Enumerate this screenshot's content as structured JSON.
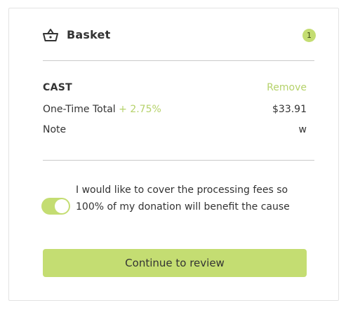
{
  "basket": {
    "title": "Basket",
    "count": "1",
    "icon": "basket-icon"
  },
  "item": {
    "name": "CAST",
    "remove_label": "Remove",
    "total_label": "One-Time Total",
    "fee_label": "+ 2.75%",
    "total_value": "$33.91",
    "note_label": "Note",
    "note_value": "w"
  },
  "fees": {
    "text": "I would like to cover the processing fees so 100% of my donation will benefit the cause",
    "enabled": true
  },
  "actions": {
    "continue_label": "Continue to review"
  },
  "colors": {
    "accent": "#c4dd72",
    "accent_text": "#b5d26a",
    "text": "#333333",
    "divider": "#c9c9c9"
  }
}
